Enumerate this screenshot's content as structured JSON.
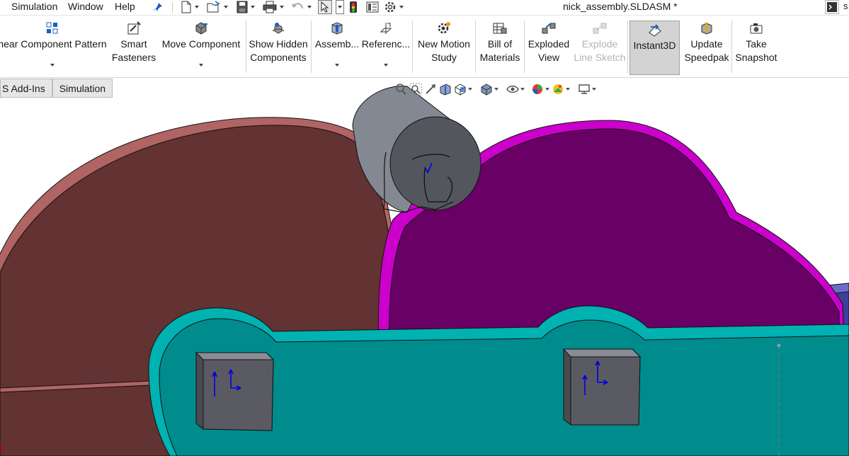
{
  "menu": {
    "items": [
      "Simulation",
      "Window",
      "Help"
    ]
  },
  "document": {
    "title": "nick_assembly.SLDASM *"
  },
  "side_panel": {
    "letter": "s"
  },
  "ribbon": {
    "linear_pattern": "near Component Pattern",
    "smart_fasteners_1": "Smart",
    "smart_fasteners_2": "Fasteners",
    "move_component": "Move Component",
    "show_hidden_1": "Show Hidden",
    "show_hidden_2": "Components",
    "assembly": "Assemb...",
    "reference": "Referenc...",
    "new_motion_1": "New Motion",
    "new_motion_2": "Study",
    "bom_1": "Bill of",
    "bom_2": "Materials",
    "exploded_1": "Exploded",
    "exploded_2": "View",
    "explode_line_1": "Explode",
    "explode_line_2": "Line Sketch",
    "instant3d": "Instant3D",
    "update_speedpak_1": "Update",
    "update_speedpak_2": "Speedpak",
    "snapshot_1": "Take",
    "snapshot_2": "Snapshot"
  },
  "tabs": [
    {
      "label": "S Add-Ins"
    },
    {
      "label": "Simulation"
    }
  ],
  "colors": {
    "brown_part": "#633232",
    "brown_edge": "#b06464",
    "purple_part": "#690066",
    "purple_edge": "#cc00cc",
    "teal_link": "#008c8c",
    "teal_light": "#00b2b2",
    "pin_gray": "#5a5a62",
    "cylinder": "#838893",
    "cylinder_cap": "#54565e",
    "triad_blue": "#0000dd"
  }
}
